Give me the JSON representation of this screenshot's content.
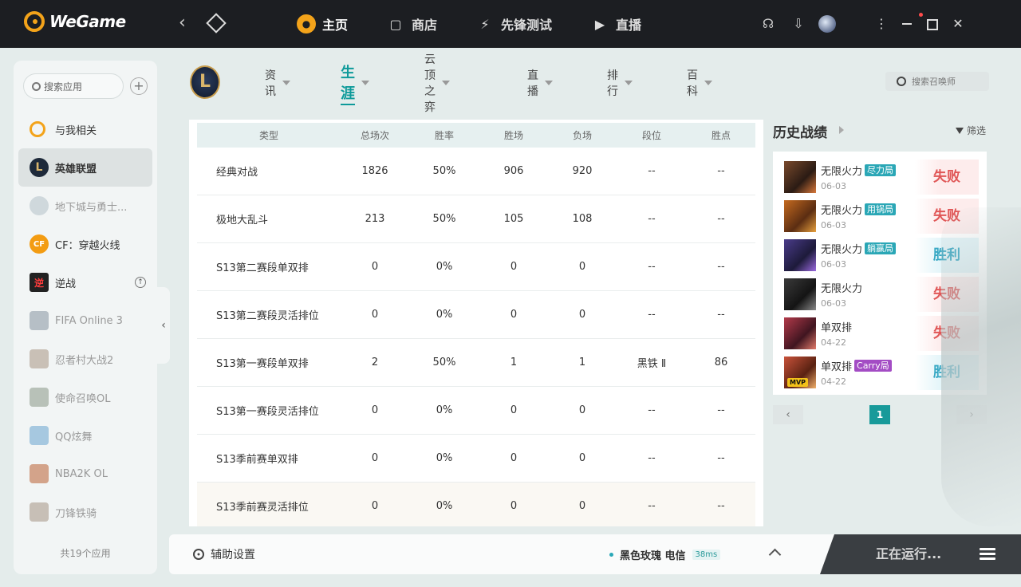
{
  "app": {
    "logo_text": "WeGame",
    "nav": [
      {
        "label": "主页",
        "icon": "home-pacman-icon"
      },
      {
        "label": "商店",
        "icon": "store-bag-icon"
      },
      {
        "label": "先锋测试",
        "icon": "test-controller-icon"
      },
      {
        "label": "直播",
        "icon": "live-play-icon"
      }
    ]
  },
  "sidebar": {
    "search_placeholder": "搜索应用",
    "items": [
      {
        "label": "与我相关",
        "icon": "wegame-logo-icon"
      },
      {
        "label": "英雄联盟",
        "icon": "lol-icon"
      },
      {
        "label": "地下城与勇士...",
        "icon": "dnf-icon"
      },
      {
        "label": "CF：穿越火线",
        "icon": "cf-icon"
      },
      {
        "label": "逆战",
        "icon": "nizhan-icon"
      },
      {
        "label": "FIFA Online 3",
        "icon": "fifa-icon"
      },
      {
        "label": "忍者村大战2",
        "icon": "ninja-icon"
      },
      {
        "label": "使命召唤OL",
        "icon": "cod-icon"
      },
      {
        "label": "QQ炫舞",
        "icon": "qqdance-icon"
      },
      {
        "label": "NBA2K OL",
        "icon": "nba-icon"
      },
      {
        "label": "刀锋铁骑",
        "icon": "sword-icon"
      }
    ],
    "count_label": "共19个应用"
  },
  "game": {
    "logo_letter": "L",
    "tabs": [
      {
        "label": "资讯"
      },
      {
        "label": "生涯"
      },
      {
        "label": "云顶之弈"
      },
      {
        "label": "直播"
      },
      {
        "label": "排行"
      },
      {
        "label": "百科"
      }
    ],
    "search_placeholder": "搜索召唤师"
  },
  "career_table": {
    "headers": [
      "类型",
      "总场次",
      "胜率",
      "胜场",
      "负场",
      "段位",
      "胜点"
    ],
    "rows": [
      [
        "经典对战",
        "1826",
        "50%",
        "906",
        "920",
        "--",
        "--"
      ],
      [
        "极地大乱斗",
        "213",
        "50%",
        "105",
        "108",
        "--",
        "--"
      ],
      [
        "S13第二赛段单双排",
        "0",
        "0%",
        "0",
        "0",
        "--",
        "--"
      ],
      [
        "S13第二赛段灵活排位",
        "0",
        "0%",
        "0",
        "0",
        "--",
        "--"
      ],
      [
        "S13第一赛段单双排",
        "2",
        "50%",
        "1",
        "1",
        "黑铁 Ⅱ",
        "86"
      ],
      [
        "S13第一赛段灵活排位",
        "0",
        "0%",
        "0",
        "0",
        "--",
        "--"
      ],
      [
        "S13季前赛单双排",
        "0",
        "0%",
        "0",
        "0",
        "--",
        "--"
      ],
      [
        "S13季前赛灵活排位",
        "0",
        "0%",
        "0",
        "0",
        "--",
        "--"
      ]
    ]
  },
  "history": {
    "title": "历史战绩",
    "filter_label": "筛选",
    "matches": [
      {
        "mode": "无限火力",
        "tag": "尽力局",
        "date": "06-03",
        "result": "失败",
        "mvp": ""
      },
      {
        "mode": "无限火力",
        "tag": "用锅局",
        "date": "06-03",
        "result": "失败",
        "mvp": ""
      },
      {
        "mode": "无限火力",
        "tag": "躺赢局",
        "date": "06-03",
        "result": "胜利",
        "mvp": ""
      },
      {
        "mode": "无限火力",
        "tag": "",
        "date": "06-03",
        "result": "失败",
        "mvp": ""
      },
      {
        "mode": "单双排",
        "tag": "",
        "date": "04-22",
        "result": "失败",
        "mvp": ""
      },
      {
        "mode": "单双排",
        "tag": "Carry局",
        "date": "04-22",
        "result": "胜利",
        "mvp": "MVP"
      }
    ],
    "pager": {
      "prev": "‹",
      "page": "1",
      "next": "›"
    }
  },
  "bottom": {
    "assist_label": "辅助设置",
    "server_name": "黑色玫瑰 电信",
    "ping": "38ms",
    "running_label": "正在运行..."
  }
}
